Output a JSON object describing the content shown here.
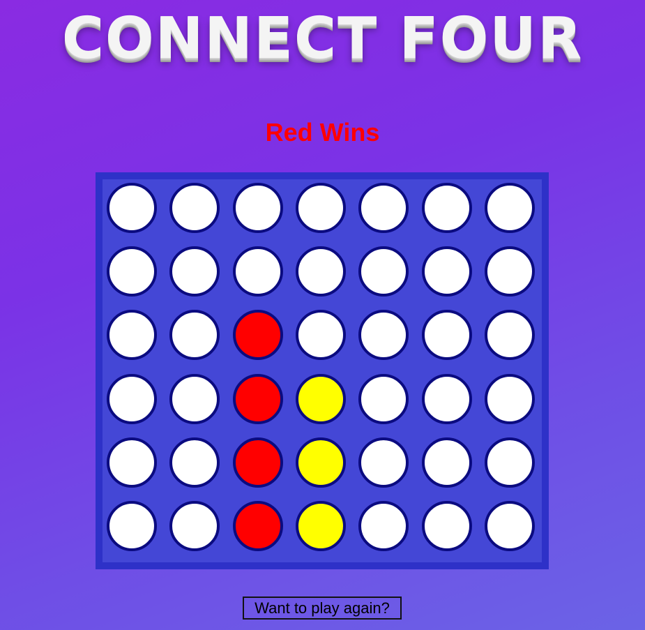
{
  "header": {
    "title": "CONNECT FOUR"
  },
  "status": {
    "text": "Red Wins",
    "color": "#ff0000"
  },
  "board": {
    "rows": 6,
    "columns": 7,
    "colors": {
      "frame": "#2e31c8",
      "surface": "#4447d6",
      "empty": "#ffffff",
      "red": "#ff0000",
      "yellow": "#ffff00",
      "ring": "#0b0b80"
    },
    "grid": [
      [
        "empty",
        "empty",
        "empty",
        "empty",
        "empty",
        "empty",
        "empty"
      ],
      [
        "empty",
        "empty",
        "empty",
        "empty",
        "empty",
        "empty",
        "empty"
      ],
      [
        "empty",
        "empty",
        "red",
        "empty",
        "empty",
        "empty",
        "empty"
      ],
      [
        "empty",
        "empty",
        "red",
        "yellow",
        "empty",
        "empty",
        "empty"
      ],
      [
        "empty",
        "empty",
        "red",
        "yellow",
        "empty",
        "empty",
        "empty"
      ],
      [
        "empty",
        "empty",
        "red",
        "yellow",
        "empty",
        "empty",
        "empty"
      ]
    ]
  },
  "controls": {
    "play_again_label": "Want to play again?"
  }
}
